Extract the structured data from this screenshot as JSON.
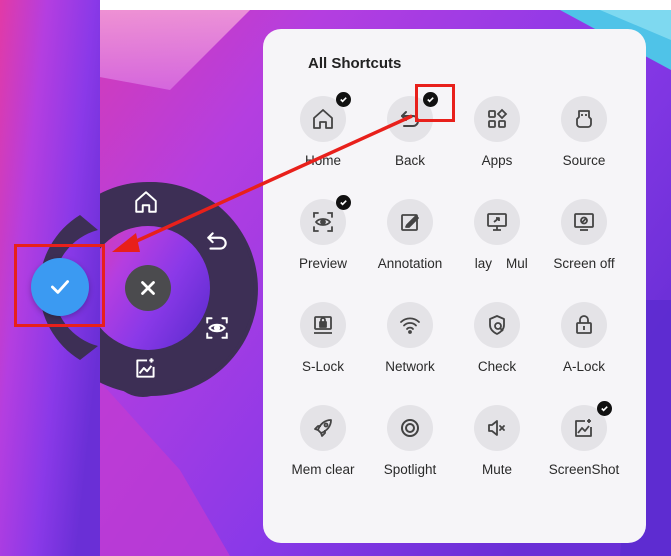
{
  "panel": {
    "title": "All Shortcuts",
    "shortcuts": [
      {
        "label": "Home",
        "icon": "home-icon",
        "checked": true
      },
      {
        "label": "Back",
        "icon": "back-icon",
        "checked": true
      },
      {
        "label": "Apps",
        "icon": "apps-icon",
        "checked": false
      },
      {
        "label": "Source",
        "icon": "source-icon",
        "checked": false
      },
      {
        "label": "Preview",
        "icon": "preview-icon",
        "checked": true
      },
      {
        "label": "Annotation",
        "icon": "annotation-icon",
        "checked": false
      },
      {
        "label": "Display",
        "icon": "display-icon",
        "checked": false
      },
      {
        "label": "Multi",
        "icon": "multi-icon",
        "checked": false
      },
      {
        "label": "Screen off",
        "icon": "screen-off-icon",
        "checked": false
      },
      {
        "label": "S-Lock",
        "icon": "s-lock-icon",
        "checked": false
      },
      {
        "label": "Network",
        "icon": "network-icon",
        "checked": false
      },
      {
        "label": "Check",
        "icon": "check-icon",
        "checked": false
      },
      {
        "label": "A-Lock",
        "icon": "a-lock-icon",
        "checked": false
      },
      {
        "label": "Mem clear",
        "icon": "rocket-icon",
        "checked": false
      },
      {
        "label": "Spotlight",
        "icon": "spotlight-icon",
        "checked": false
      },
      {
        "label": "Mute",
        "icon": "mute-icon",
        "checked": false
      },
      {
        "label": "ScreenShot",
        "icon": "screenshot-icon",
        "checked": true
      }
    ]
  },
  "radial_menu": {
    "items": [
      "home-icon",
      "back-icon",
      "preview-icon",
      "screenshot-icon"
    ],
    "confirm": "check-icon",
    "close": "close-icon"
  },
  "colors": {
    "confirm_blue": "#3b9af2",
    "highlight_red": "#e8201b",
    "menu_dark": "#3d2f55"
  }
}
